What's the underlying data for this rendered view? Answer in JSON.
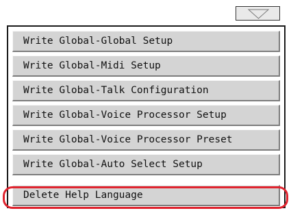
{
  "dropdown": {
    "icon": "chevron-down-icon"
  },
  "menu": {
    "items": [
      {
        "label": "Write Global-Global Setup"
      },
      {
        "label": "Write Global-Midi Setup"
      },
      {
        "label": "Write Global-Talk Configuration"
      },
      {
        "label": "Write Global-Voice Processor Setup"
      },
      {
        "label": "Write Global-Voice Processor Preset"
      },
      {
        "label": "Write Global-Auto Select Setup"
      },
      {
        "label": "Delete Help Language"
      }
    ]
  },
  "colors": {
    "item_background": "#d4d4d4",
    "highlight": "#e0232e"
  }
}
